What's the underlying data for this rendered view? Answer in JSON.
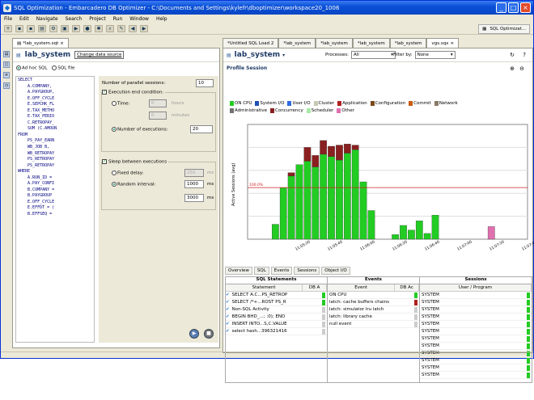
{
  "window": {
    "title": "SQL Optimization - Embarcadero DB Optimizer - C:\\Documents and Settings\\kylefr\\dboptimizer\\workspace20_1006"
  },
  "menu": [
    "File",
    "Edit",
    "Navigate",
    "Search",
    "Project",
    "Run",
    "Window",
    "Help"
  ],
  "perspective": {
    "label": "SQL Optimizat..."
  },
  "left_tab": {
    "label": "*lab_system.sqt"
  },
  "left": {
    "title": "lab_system",
    "change_source": "Change data source",
    "radio_adhoc": "Ad hoc SQL",
    "radio_file": "SQL file",
    "code": [
      "SELECT",
      "    A.COMPANY,",
      "    A.PAYGROUP,",
      "    E.OFF_CYCLE",
      "    E.SEPCHK_FL",
      "    E.TAX_METHO",
      "    E.TAX_PERIO",
      "    C.RETROPAY_",
      "    SUM (C.AMOUN",
      "FROM",
      "    PS_PAY_EARN",
      "    WB_JOB B,",
      "    WB_RETROPAY",
      "    PS_RETROPAY",
      "    PS_RETROPAY",
      "WHERE",
      "    A.RUN_ID =",
      "    A.PAY_CONFI",
      "    B.COMPANY =",
      "    B.PAYGROUP",
      "    E.OFF_CYCLE",
      "    E.EFFDT = (",
      "",
      "",
      "",
      "",
      "",
      "",
      "",
      "",
      "",
      "",
      "",
      "    B.EFFSEQ ="
    ],
    "parallel_label": "Number of parallel sessions:",
    "parallel_value": "10",
    "exec_label": "Execution end condition:",
    "time_label": "Time:",
    "hours": "hours",
    "minutes": "minutes",
    "time_h": "0",
    "time_m": "0",
    "num_exec_label": "Number of executions:",
    "num_exec_value": "20",
    "sleep_label": "Sleep between executions",
    "fixed_label": "Fixed delay:",
    "fixed_value": "250",
    "ms": "ms",
    "random_label": "Random interval:",
    "random_min": "1000",
    "random_max": "3000"
  },
  "right_tabs": [
    "*Untitled SQL Load 2",
    "*lab_system",
    "*lab_system",
    "*lab_system",
    "*lab_system",
    "vgs.sqx"
  ],
  "right": {
    "title": "lab_system",
    "processes_label": "Processes:",
    "processes_value": "All",
    "filter_label": "Filter by:",
    "filter_value": "None",
    "profile_label": "Profile Session"
  },
  "legend": [
    {
      "name": "ON CPU",
      "color": "#22cc22"
    },
    {
      "name": "System I/O",
      "color": "#1f4fb5"
    },
    {
      "name": "User I/O",
      "color": "#2e6be0"
    },
    {
      "name": "Cluster",
      "color": "#c8c8b4"
    },
    {
      "name": "Application",
      "color": "#b02020"
    },
    {
      "name": "Configuration",
      "color": "#7a4a1a"
    },
    {
      "name": "Commit",
      "color": "#c85a10"
    },
    {
      "name": "Network",
      "color": "#8a7a6a"
    },
    {
      "name": "Administrative",
      "color": "#707070"
    },
    {
      "name": "Concurrency",
      "color": "#8a1f1f"
    },
    {
      "name": "Scheduler",
      "color": "#a8e8a8"
    },
    {
      "name": "Other",
      "color": "#e070b0"
    }
  ],
  "chart_data": {
    "type": "bar",
    "ylabel": "Active Sessions (avg)",
    "ylim": [
      0,
      10
    ],
    "reference_label": "100.0%",
    "reference_value": 4.5,
    "x_ticks": [
      "11:05:20",
      "11:05:40",
      "11:06:00",
      "11:06:20",
      "11:06:40",
      "11:07:00",
      "11:07:20",
      "11:07:40"
    ],
    "series": [
      {
        "name": "ON CPU",
        "color": "#22cc22",
        "values": [
          0,
          0,
          0,
          1.3,
          4.5,
          5.5,
          6.5,
          6.8,
          6.3,
          7.4,
          7.2,
          6.9,
          7.5,
          7.8,
          5,
          2.5,
          0,
          0,
          0.4,
          1.2,
          0.8,
          1.6,
          0.5,
          2.1,
          0,
          0,
          0,
          0,
          0,
          0,
          0,
          0,
          0,
          0,
          0
        ]
      },
      {
        "name": "Concurrency",
        "color": "#8a1f1f",
        "values": [
          0,
          0,
          0,
          0,
          0,
          0.3,
          0,
          1.2,
          1,
          1.2,
          0.9,
          1.3,
          0.8,
          0.4,
          0,
          0,
          0,
          0,
          0,
          0,
          0,
          0,
          0,
          0,
          0,
          0,
          0,
          0,
          0,
          0,
          0,
          0,
          0,
          0,
          0
        ]
      },
      {
        "name": "Other",
        "color": "#e070b0",
        "values": [
          0,
          0,
          0,
          0,
          0,
          0,
          0,
          0,
          0,
          0,
          0,
          0,
          0,
          0,
          0,
          0,
          0,
          0,
          0,
          0,
          0,
          0,
          0,
          0,
          0,
          0,
          0,
          0,
          0,
          0,
          1.1,
          0,
          0,
          0,
          0
        ]
      }
    ]
  },
  "bottom_tabs": [
    "Overview",
    "SQL",
    "Events",
    "Sessions",
    "Object I/O"
  ],
  "sql_header": "SQL Statements",
  "events_header": "Events",
  "sessions_header": "Sessions",
  "sql_cols": [
    "Statement",
    "DB A"
  ],
  "events_cols": [
    "Event",
    "DB Ac"
  ],
  "sessions_cols": [
    "User / Program"
  ],
  "statements": [
    {
      "text": "SELECT A.C...PS_RETROP",
      "bar": "#22cc22"
    },
    {
      "text": "SELECT /*+...ROST PS_R",
      "bar": "#22cc22"
    },
    {
      "text": "Non-SQL Activity",
      "bar": "#cccccc"
    },
    {
      "text": "BEGIN BHD_...; :0); END",
      "bar": "#cccccc"
    },
    {
      "text": "INSERT INTO...S,C.VALUE",
      "bar": "#cccccc"
    },
    {
      "text": "select hash...396321416",
      "bar": "#cccccc"
    }
  ],
  "events": [
    {
      "text": "ON CPU",
      "bar": "#22cc22"
    },
    {
      "text": "latch: cache buffers chains",
      "bar": "#b02020"
    },
    {
      "text": "latch: simulator lru latch",
      "bar": "#cccccc"
    },
    {
      "text": "latch: library cache",
      "bar": "#cccccc"
    },
    {
      "text": "null event",
      "bar": "#cccccc"
    }
  ],
  "sessions": [
    "SYSTEM",
    "SYSTEM",
    "SYSTEM",
    "SYSTEM",
    "SYSTEM",
    "SYSTEM",
    "SYSTEM",
    "SYSTEM",
    "SYSTEM",
    "SYSTEM",
    "SYSTEM",
    "SYSTEM"
  ]
}
